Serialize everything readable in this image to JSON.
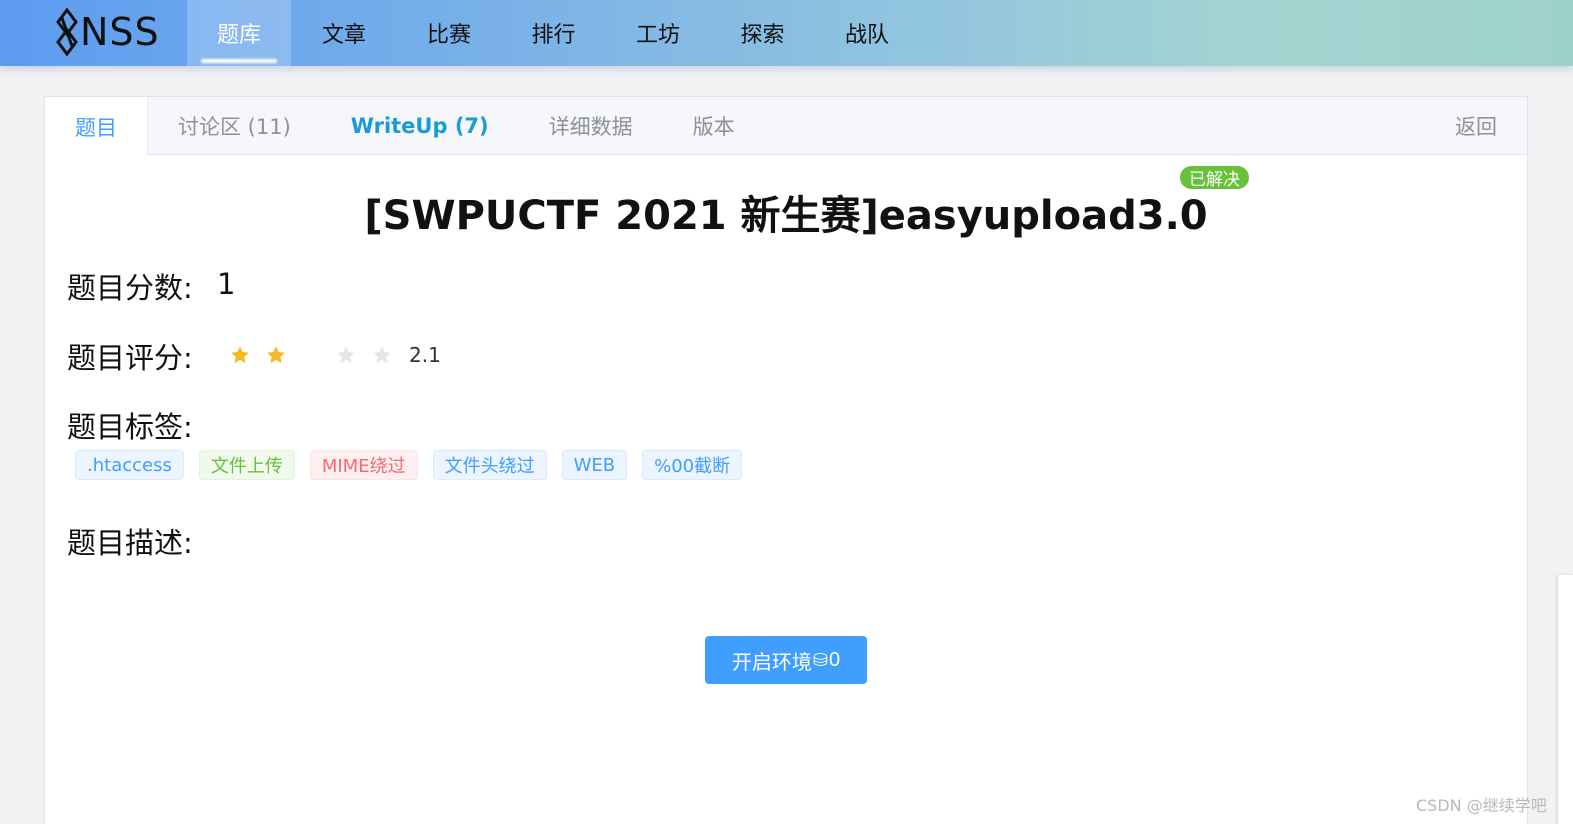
{
  "topnav": {
    "logo_text": "NSS",
    "items": [
      "题库",
      "文章",
      "比赛",
      "排行",
      "工坊",
      "探索",
      "战队"
    ],
    "active_index": 0
  },
  "tabs": {
    "problem": "题目",
    "discussion": "讨论区 (11)",
    "writeup": "WriteUp (7)",
    "details": "详细数据",
    "version": "版本",
    "back": "返回"
  },
  "problem": {
    "title": "[SWPUCTF 2021 新生赛]easyupload3.0",
    "status_badge": "已解决",
    "score_label": "题目分数:",
    "score_value": "1",
    "rating_label": "题目评分:",
    "rating_value": "2.1",
    "rating_stars": 2,
    "rating_max": 4,
    "tags_label": "题目标签:",
    "tags": [
      {
        "text": ".htaccess",
        "color": "blue"
      },
      {
        "text": "文件上传",
        "color": "green"
      },
      {
        "text": "MIME绕过",
        "color": "red"
      },
      {
        "text": "文件头绕过",
        "color": "blue"
      },
      {
        "text": "WEB",
        "color": "blue"
      },
      {
        "text": "%00截断",
        "color": "blue"
      }
    ],
    "description_label": "题目描述:",
    "start_button": {
      "label": "开启环境",
      "coin_icon": "⛁",
      "cost": "0"
    }
  },
  "colors": {
    "accent": "#409eff",
    "star_on": "#f7ba2a",
    "star_off": "#e6e6e6",
    "solved": "#67c23a"
  },
  "watermark": "CSDN @继续学吧"
}
